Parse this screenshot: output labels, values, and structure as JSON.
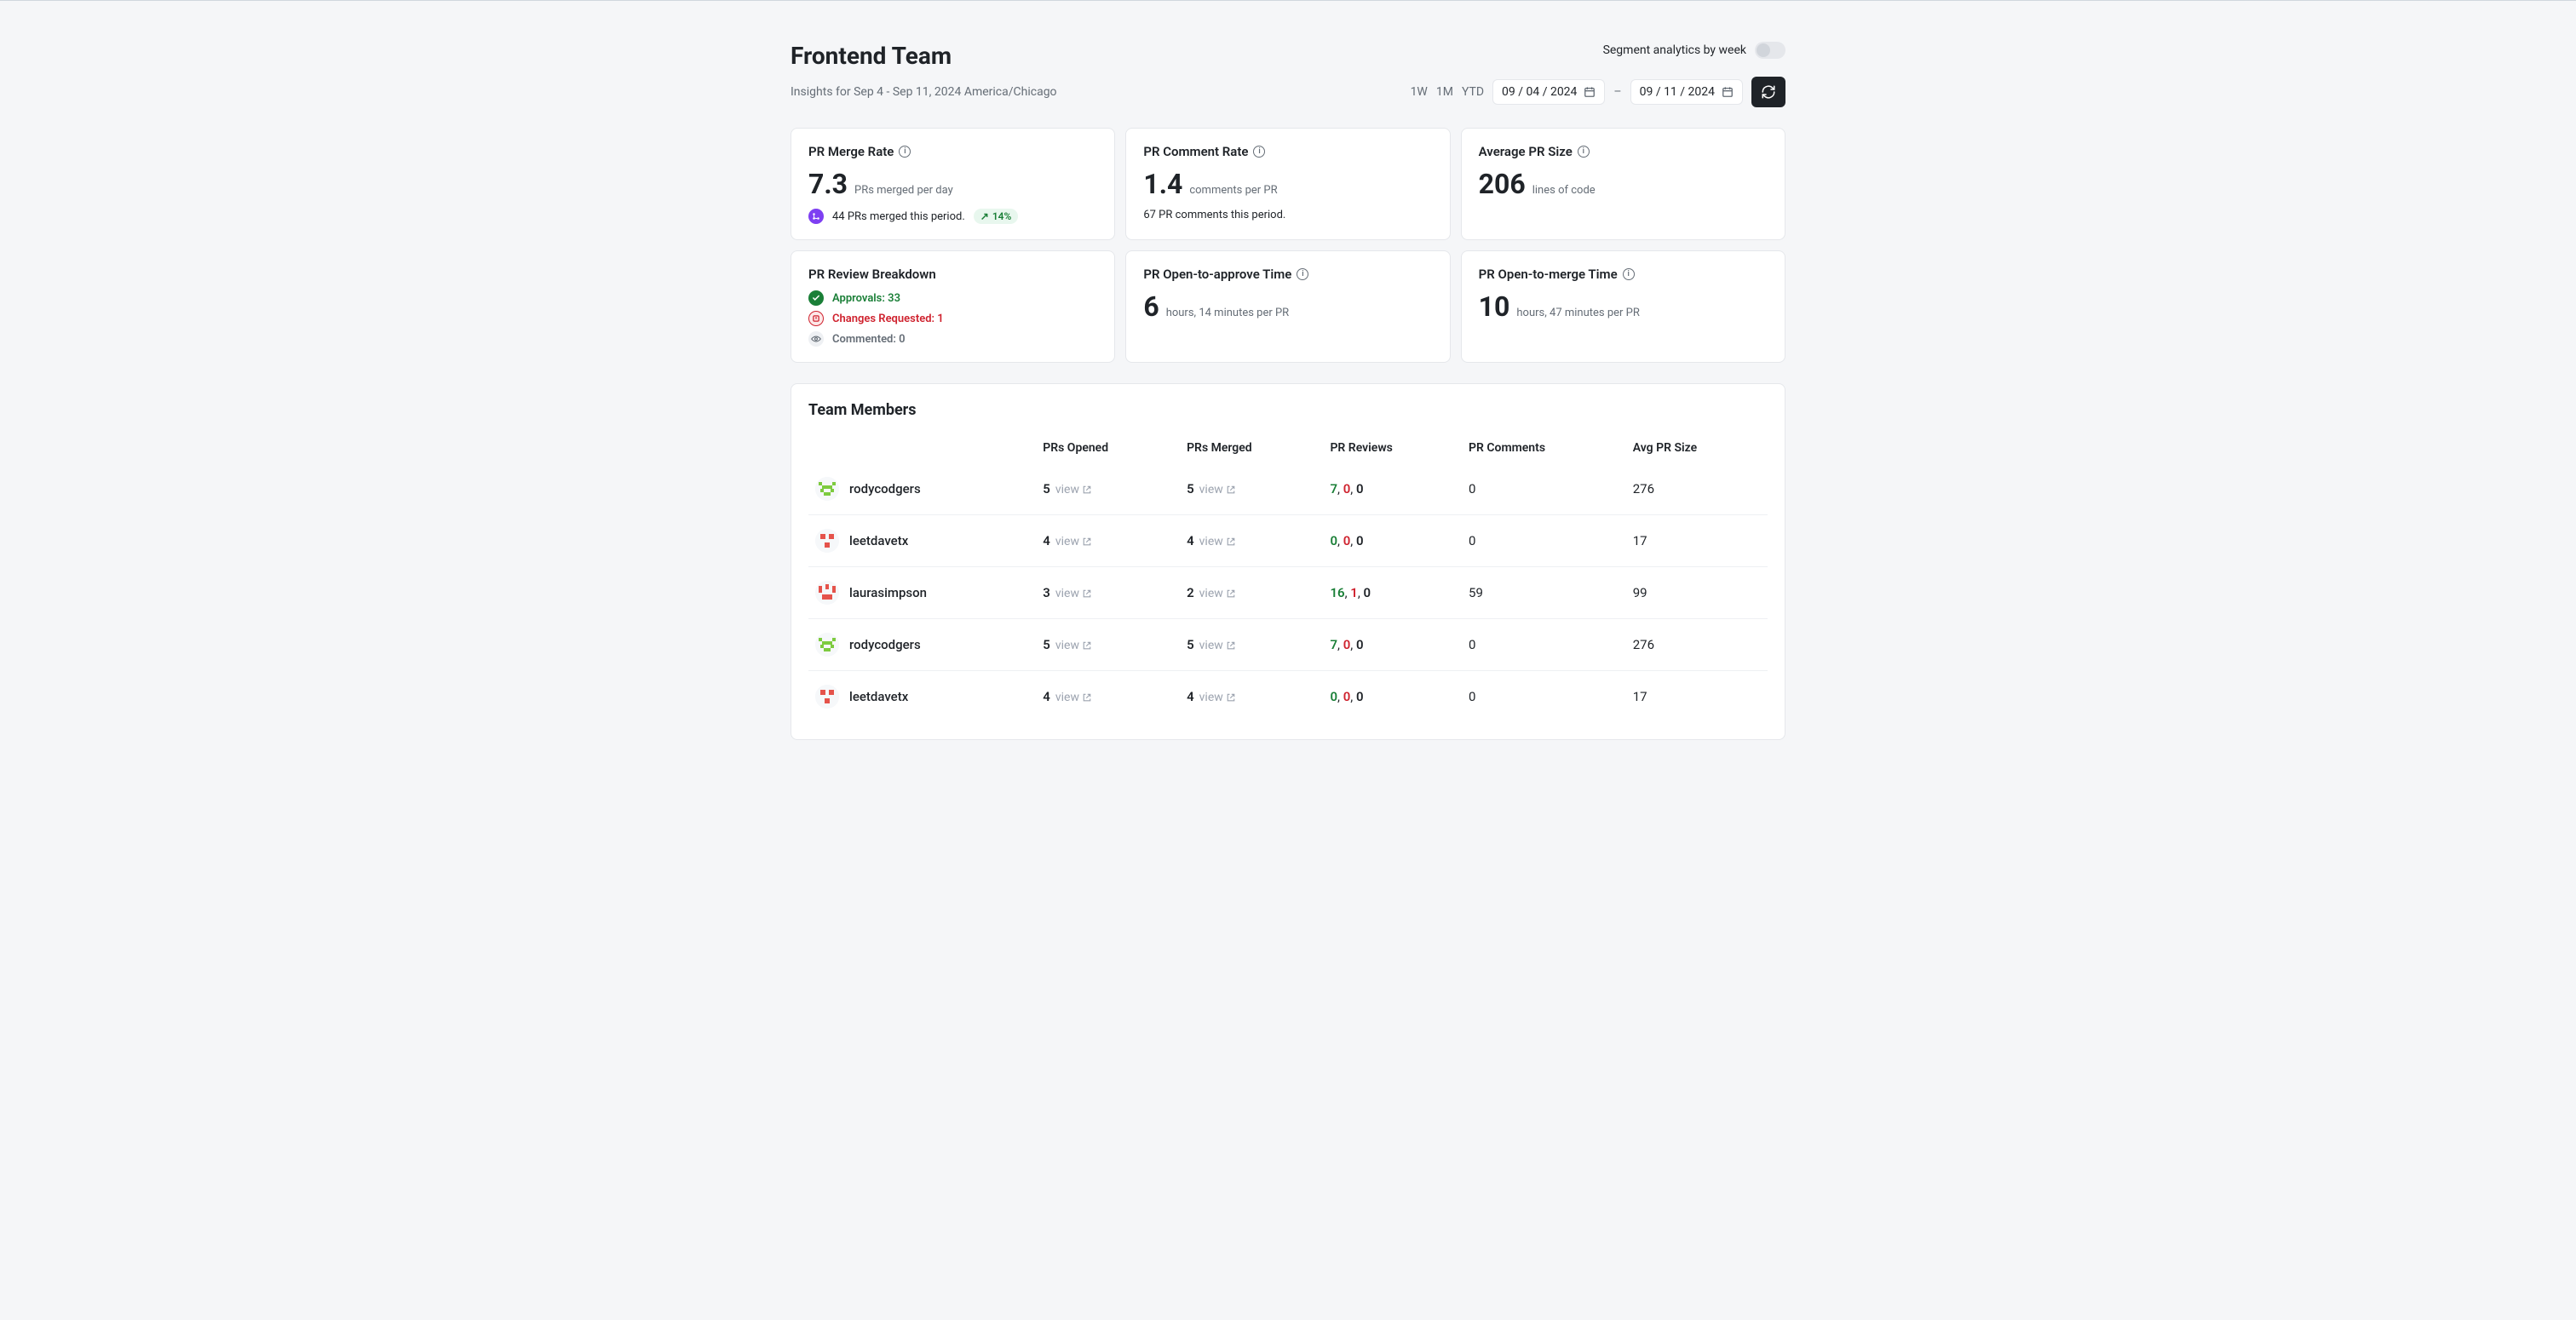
{
  "header": {
    "title": "Frontend Team",
    "toggle_label": "Segment analytics by week",
    "insights_label": "Insights for Sep 4 - Sep 11, 2024 America/Chicago",
    "range_options": [
      "1W",
      "1M",
      "YTD"
    ],
    "date_from": "09 / 04 / 2024",
    "date_to": "09 / 11 / 2024",
    "date_separator": "–"
  },
  "cards": {
    "merge_rate": {
      "title": "PR Merge Rate",
      "value": "7.3",
      "unit": "PRs merged per day",
      "sub": "44 PRs merged this period.",
      "trend": "14%"
    },
    "comment_rate": {
      "title": "PR Comment Rate",
      "value": "1.4",
      "unit": "comments per PR",
      "sub": "67 PR comments this period."
    },
    "avg_size": {
      "title": "Average PR Size",
      "value": "206",
      "unit": "lines of code"
    },
    "review_breakdown": {
      "title": "PR Review Breakdown",
      "approvals": "Approvals: 33",
      "changes": "Changes Requested: 1",
      "commented": "Commented: 0"
    },
    "open_approve": {
      "title": "PR Open-to-approve Time",
      "value": "6",
      "unit": "hours, 14 minutes per PR"
    },
    "open_merge": {
      "title": "PR Open-to-merge Time",
      "value": "10",
      "unit": "hours, 47 minutes per PR"
    }
  },
  "members": {
    "title": "Team Members",
    "columns": [
      "",
      "PRs Opened",
      "PRs Merged",
      "PR Reviews",
      "PR Comments",
      "Avg PR Size"
    ],
    "view_label": "view",
    "rows": [
      {
        "name": "rodycodgers",
        "avatar": "green",
        "opened": "5",
        "merged": "5",
        "reviews": [
          "7",
          "0",
          "0"
        ],
        "comments": "0",
        "size": "276"
      },
      {
        "name": "leetdavetx",
        "avatar": "red",
        "opened": "4",
        "merged": "4",
        "reviews": [
          "0",
          "0",
          "0"
        ],
        "comments": "0",
        "size": "17"
      },
      {
        "name": "laurasimpson",
        "avatar": "red2",
        "opened": "3",
        "merged": "2",
        "reviews": [
          "16",
          "1",
          "0"
        ],
        "comments": "59",
        "size": "99"
      },
      {
        "name": "rodycodgers",
        "avatar": "green",
        "opened": "5",
        "merged": "5",
        "reviews": [
          "7",
          "0",
          "0"
        ],
        "comments": "0",
        "size": "276"
      },
      {
        "name": "leetdavetx",
        "avatar": "red",
        "opened": "4",
        "merged": "4",
        "reviews": [
          "0",
          "0",
          "0"
        ],
        "comments": "0",
        "size": "17"
      }
    ]
  }
}
